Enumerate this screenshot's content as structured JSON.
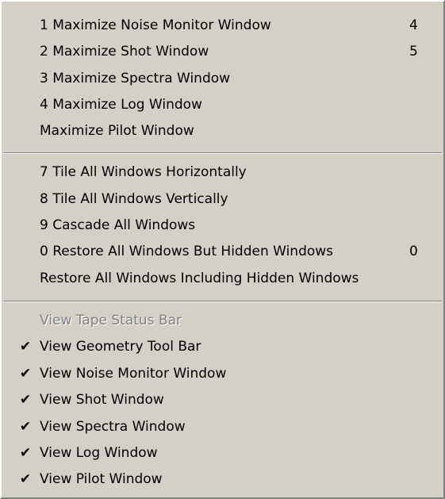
{
  "menu": {
    "group1": [
      {
        "label": "1 Maximize Noise Monitor Window",
        "shortcut": "4"
      },
      {
        "label": "2 Maximize Shot Window",
        "shortcut": "5"
      },
      {
        "label": "3 Maximize Spectra Window",
        "shortcut": ""
      },
      {
        "label": "4 Maximize Log Window",
        "shortcut": ""
      },
      {
        "label": "Maximize Pilot Window",
        "shortcut": ""
      }
    ],
    "group2": [
      {
        "label": "7 Tile All Windows Horizontally",
        "shortcut": ""
      },
      {
        "label": "8 Tile All Windows Vertically",
        "shortcut": ""
      },
      {
        "label": "9 Cascade All Windows",
        "shortcut": ""
      },
      {
        "label": "0 Restore All Windows But Hidden Windows",
        "shortcut": "0"
      },
      {
        "label": "Restore All Windows Including Hidden Windows",
        "shortcut": ""
      }
    ],
    "group3": [
      {
        "label": "View Tape Status Bar",
        "checked": false,
        "enabled": false
      },
      {
        "label": "View Geometry Tool Bar",
        "checked": true,
        "enabled": true
      },
      {
        "label": "View Noise Monitor Window",
        "checked": true,
        "enabled": true
      },
      {
        "label": "View Shot Window",
        "checked": true,
        "enabled": true
      },
      {
        "label": "View Spectra  Window",
        "checked": true,
        "enabled": true
      },
      {
        "label": "View Log Window",
        "checked": true,
        "enabled": true
      },
      {
        "label": "View Pilot Window",
        "checked": true,
        "enabled": true
      }
    ],
    "check_glyph": "✔",
    "colors": {
      "background": "#d4d0c8",
      "disabled_text": "#808080",
      "separator_dark": "#808080",
      "separator_light": "#ffffff"
    }
  }
}
